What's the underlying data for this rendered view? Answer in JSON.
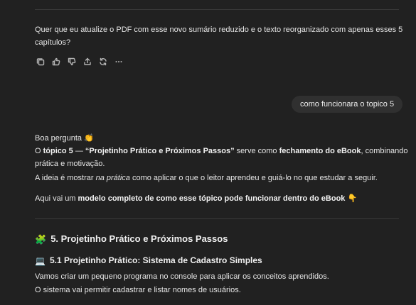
{
  "user_question": "Quer que eu atualize o PDF com esse novo sumário reduzido e o texto reorganizado com apenas esses 5",
  "user_question_line2": "capítulos?",
  "actions": [
    "copy-icon",
    "thumbs-up-icon",
    "thumbs-down-icon",
    "share-icon",
    "regenerate-icon",
    "more-icon"
  ],
  "user_bubble": "como funcionara o topico 5",
  "response": {
    "greeting": "Boa pergunta",
    "line1_pre": "O ",
    "line1_b1": "tópico 5",
    "line1_mid1": " — ",
    "line1_b2": "“Projetinho Prático e Próximos Passos”",
    "line1_mid2": " serve como ",
    "line1_b3": "fechamento do eBook",
    "line1_post": ", combinando",
    "line2": "prática e motivação.",
    "line3_pre": "A ideia é mostrar ",
    "line3_i": "na prática",
    "line3_post": " como aplicar o que o leitor aprendeu e guiá-lo no que estudar a seguir.",
    "line4_pre": "Aqui vai um ",
    "line4_b": "modelo completo de como esse tópico pode funcionar dentro do eBook",
    "section_title": "5. Projetinho Prático e Próximos Passos",
    "subsection_title": "5.1 Projetinho Prático: Sistema de Cadastro Simples",
    "para1": "Vamos criar um pequeno programa no console para aplicar os conceitos aprendidos.",
    "para2": "O sistema vai permitir cadastrar e listar nomes de usuários."
  }
}
